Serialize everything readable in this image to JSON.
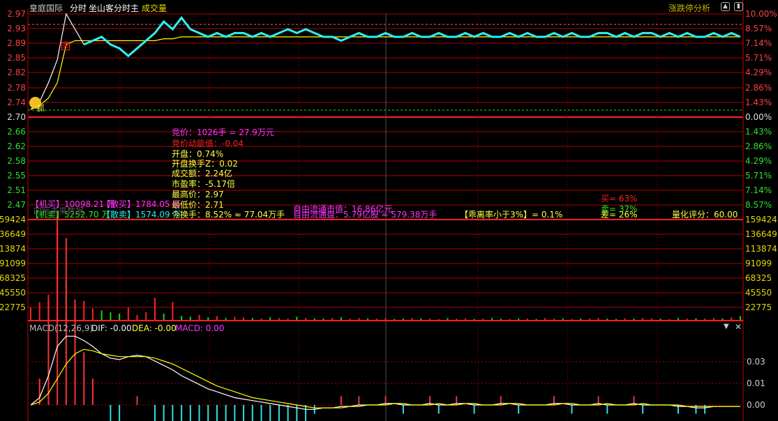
{
  "header": {
    "stock_name": "皇庭国际",
    "mode": "分时",
    "indicator": "坐山客分时主",
    "volume_label": "成交量",
    "limit_analysis": "涨跌停分析"
  },
  "axes": {
    "price_left": [
      "2.97",
      "2.93",
      "2.89",
      "2.85",
      "2.82",
      "2.78",
      "2.74",
      "2.70",
      "2.66",
      "2.62",
      "2.58",
      "2.55",
      "2.51",
      "2.47"
    ],
    "pct_right": [
      "10.00%",
      "8.57%",
      "7.14%",
      "5.71%",
      "4.29%",
      "2.86%",
      "1.43%",
      "0.00%",
      "1.43%",
      "2.86%",
      "4.29%",
      "5.71%",
      "7.14%",
      "8.57%"
    ],
    "volume_left": [
      "159424",
      "136649",
      "113874",
      "91099",
      "68325",
      "45550",
      "22775"
    ],
    "volume_right": [
      "159424",
      "136649",
      "113874",
      "91099",
      "68325",
      "45550",
      "22775"
    ],
    "macd_right": [
      "0.03",
      "0.01",
      "0.00"
    ]
  },
  "info": {
    "auction": "竞价：1026手 = 27.9万元",
    "auction_momentum": "竞价动能值：-0.04",
    "open": "开盘：0.74%",
    "open_turnover": "开盘换手Z：0.02",
    "amount": "成交额：2.24亿",
    "pe": "市盈率：-5.17倍",
    "high": "最高价：2.97",
    "low": "最低价：2.71",
    "turnover": "今换手：8.52% ≈ 77.04万手",
    "free_mcap": "自由流通市值：16.86亿元",
    "free_float": "自由流通盘：5.79亿股 ≈ 579.38万手",
    "inst_buy": "【机买】10098.21 万",
    "retail_buy": "【散买】1784.05 万",
    "inst_sell": "【机卖】5252.70 万",
    "retail_sell": "【散卖】1574.09 万",
    "watermark": "四际未来数据",
    "deviation": "【乖离率小于3%】= 0.1%",
    "buy_ratio": "买= 63%",
    "sell_ratio": "卖= 37%",
    "diff_ratio": "差= 26%",
    "score": "量化评分：60.00",
    "buy_marker": "抓",
    "sell_marker": "卖"
  },
  "macd": {
    "title": "MACD(12,26,9)",
    "dif": "DIF: -0.00",
    "dea": "DEA: -0.00",
    "macd": "MACD: 0.00"
  },
  "chart_data": {
    "type": "line",
    "price": [
      2.72,
      2.74,
      2.79,
      2.85,
      2.97,
      2.93,
      2.89,
      2.9,
      2.91,
      2.89,
      2.88,
      2.86,
      2.88,
      2.9,
      2.92,
      2.95,
      2.93,
      2.96,
      2.93,
      2.92,
      2.91,
      2.92,
      2.91,
      2.92,
      2.92,
      2.91,
      2.92,
      2.91,
      2.92,
      2.93,
      2.92,
      2.93,
      2.92,
      2.91,
      2.91,
      2.9,
      2.91,
      2.92,
      2.91,
      2.91,
      2.92,
      2.91,
      2.91,
      2.92,
      2.91,
      2.91,
      2.92,
      2.91,
      2.91,
      2.92,
      2.91,
      2.92,
      2.91,
      2.91,
      2.92,
      2.91,
      2.92,
      2.91,
      2.91,
      2.92,
      2.91,
      2.92,
      2.91,
      2.91,
      2.92,
      2.92,
      2.91,
      2.92,
      2.91,
      2.92,
      2.92,
      2.91,
      2.92,
      2.91,
      2.92,
      2.91,
      2.91,
      2.92,
      2.91,
      2.92,
      2.91
    ],
    "avg": [
      2.72,
      2.73,
      2.75,
      2.79,
      2.89,
      2.9,
      2.9,
      2.9,
      2.9,
      2.9,
      2.9,
      2.9,
      2.9,
      2.9,
      2.9,
      2.905,
      2.905,
      2.91,
      2.91,
      2.91,
      2.91,
      2.91,
      2.91,
      2.91,
      2.91,
      2.91,
      2.91,
      2.91,
      2.91,
      2.91,
      2.91,
      2.91,
      2.91,
      2.91,
      2.91,
      2.91,
      2.91,
      2.91,
      2.91,
      2.91,
      2.91,
      2.91,
      2.91,
      2.91,
      2.91,
      2.91,
      2.91,
      2.91,
      2.91,
      2.91,
      2.91,
      2.91,
      2.91,
      2.91,
      2.91,
      2.91,
      2.91,
      2.91,
      2.91,
      2.91,
      2.91,
      2.91,
      2.91,
      2.91,
      2.91,
      2.91,
      2.91,
      2.91,
      2.91,
      2.91,
      2.91,
      2.91,
      2.91,
      2.91,
      2.91,
      2.91,
      2.91,
      2.91,
      2.91,
      2.91,
      2.91
    ],
    "volume": [
      20000,
      28000,
      40000,
      145000,
      60000,
      25000,
      30000,
      18000,
      15000,
      12000,
      10000,
      20000,
      8000,
      12000,
      35000,
      10000,
      28000,
      6000,
      5000,
      8000,
      4000,
      6000,
      3000,
      5000,
      4000,
      3000,
      2500,
      4000,
      3000,
      2000,
      5000,
      3000,
      2500,
      2000,
      3000,
      4000,
      2000,
      3000,
      2500,
      2000,
      3000,
      1500,
      2000,
      3000,
      2500,
      2000,
      1500,
      3000,
      2000,
      2500,
      1500,
      2000,
      3000,
      2000,
      1500,
      2500,
      2000,
      1500,
      3000,
      2000,
      2500,
      1500,
      2000,
      2500,
      3000,
      2000,
      1500,
      2500,
      2000,
      3000,
      2500,
      2000,
      1500,
      3000,
      2000,
      2500,
      2000,
      3000,
      2500,
      4000,
      6000
    ],
    "volume_up": [
      1,
      1,
      1,
      1,
      0,
      0,
      1,
      1,
      0,
      0,
      0,
      1,
      1,
      1,
      1,
      0,
      1,
      0,
      0,
      1,
      0,
      1,
      0,
      1,
      1,
      0,
      1,
      0,
      1,
      1,
      0,
      1,
      0,
      0,
      1,
      0,
      1,
      1,
      0,
      1,
      1,
      0,
      0,
      1,
      0,
      1,
      1,
      0,
      1,
      1,
      0,
      1,
      0,
      0,
      1,
      0,
      1,
      0,
      1,
      1,
      0,
      1,
      0,
      1,
      1,
      0,
      0,
      1,
      0,
      1,
      1,
      0,
      1,
      0,
      1,
      0,
      1,
      1,
      0,
      1,
      0
    ],
    "dif": [
      0,
      0.005,
      0.02,
      0.04,
      0.047,
      0.047,
      0.044,
      0.04,
      0.035,
      0.032,
      0.031,
      0.033,
      0.034,
      0.033,
      0.03,
      0.027,
      0.024,
      0.02,
      0.017,
      0.014,
      0.011,
      0.009,
      0.007,
      0.005,
      0.004,
      0.003,
      0.002,
      0.001,
      0,
      -0.001,
      -0.002,
      -0.003,
      -0.003,
      -0.002,
      -0.002,
      -0.001,
      -0.001,
      0,
      0,
      0,
      0.001,
      0.001,
      0,
      0,
      0,
      0.001,
      0,
      0,
      0.001,
      0.001,
      0,
      0,
      0,
      0.001,
      0.001,
      0,
      0,
      0,
      0,
      0.001,
      0.001,
      0,
      0,
      0,
      0.001,
      0,
      0,
      0,
      0.001,
      0,
      0,
      0,
      0,
      -0.001,
      -0.001,
      -0.002,
      -0.002,
      -0.001,
      -0.001,
      -0.001,
      -0.001
    ],
    "dea": [
      0,
      0.002,
      0.008,
      0.018,
      0.028,
      0.035,
      0.038,
      0.037,
      0.035,
      0.034,
      0.033,
      0.033,
      0.033,
      0.033,
      0.032,
      0.03,
      0.028,
      0.025,
      0.022,
      0.019,
      0.016,
      0.013,
      0.011,
      0.009,
      0.007,
      0.005,
      0.004,
      0.003,
      0.002,
      0.001,
      0,
      -0.001,
      -0.002,
      -0.002,
      -0.002,
      -0.002,
      -0.001,
      -0.001,
      0,
      0,
      0,
      0.001,
      0.001,
      0,
      0,
      0,
      0.001,
      0,
      0,
      0.001,
      0.001,
      0,
      0,
      0,
      0.001,
      0.001,
      0,
      0,
      0,
      0,
      0.001,
      0.001,
      0,
      0,
      0,
      0.001,
      0,
      0,
      0,
      0.001,
      0,
      0,
      0,
      0,
      -0.001,
      -0.001,
      -0.001,
      -0.001,
      -0.001,
      -0.001,
      -0.001
    ],
    "price_range": [
      2.47,
      2.97
    ],
    "pre_close": 2.7,
    "volume_max": 159424
  }
}
